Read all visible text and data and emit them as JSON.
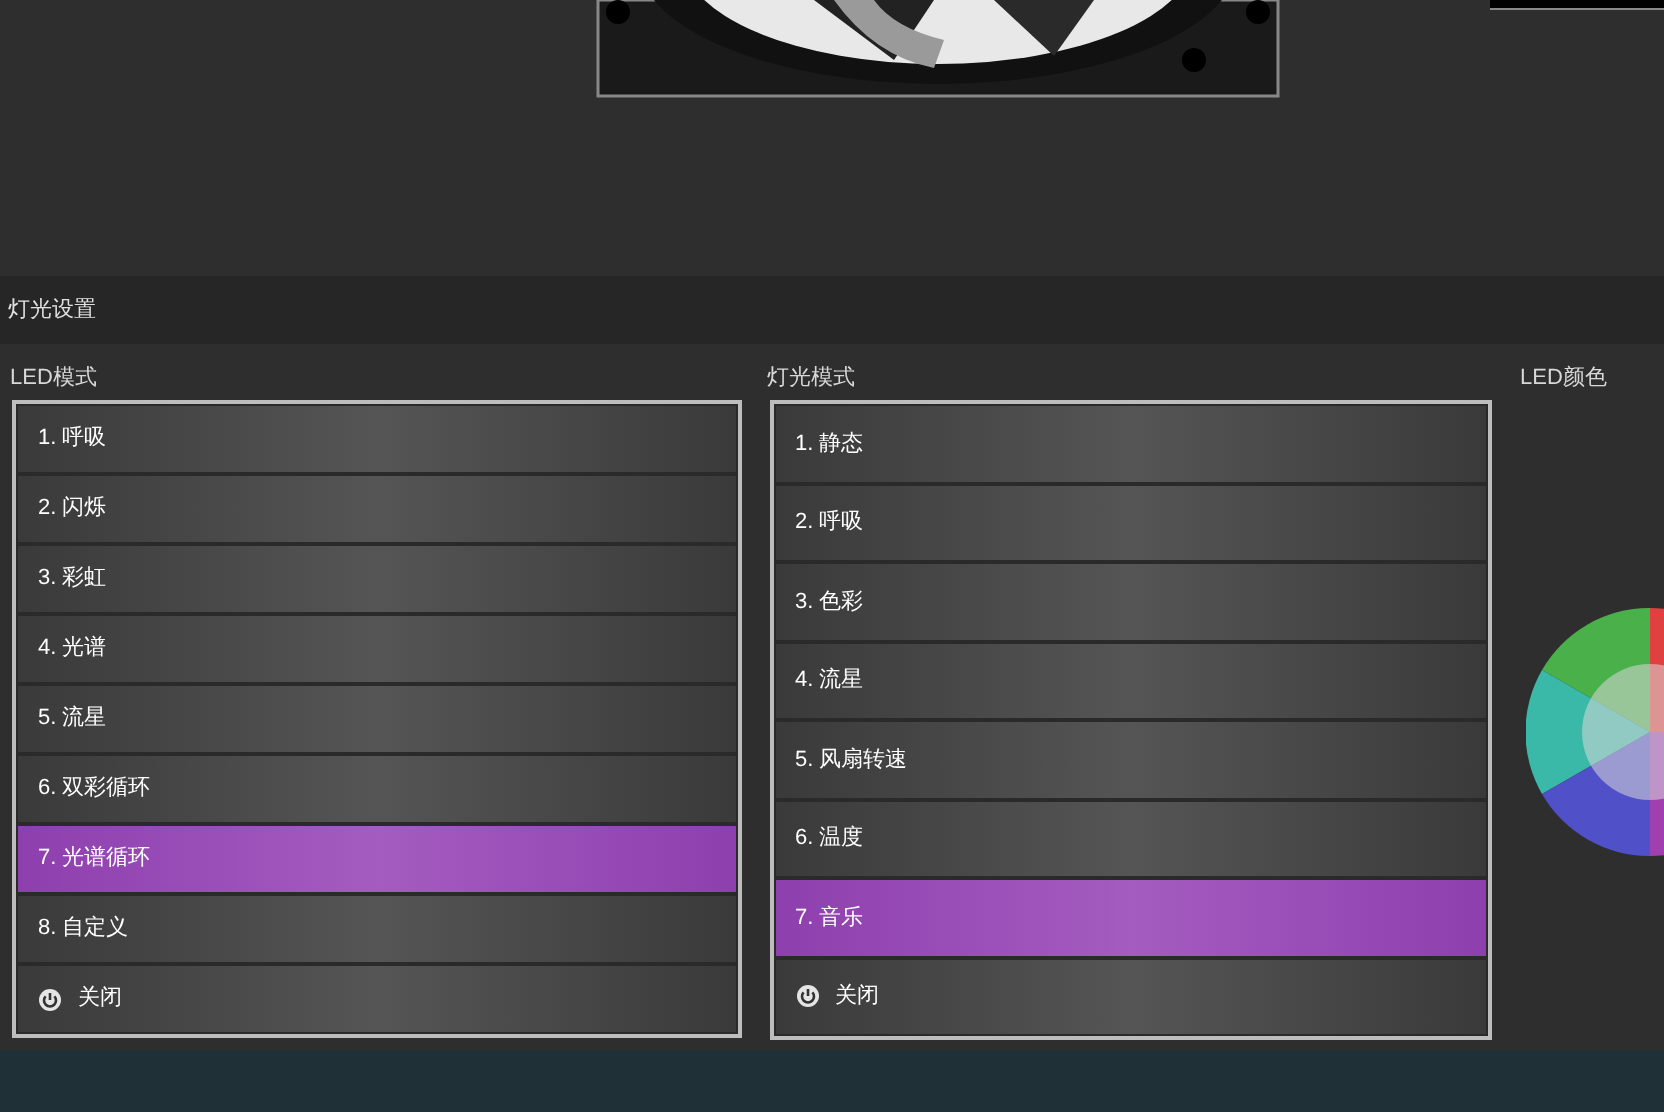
{
  "section_title": "灯光设置",
  "led_mode": {
    "label": "LED模式",
    "items": [
      {
        "text": "1. 呼吸",
        "selected": false
      },
      {
        "text": "2. 闪烁",
        "selected": false
      },
      {
        "text": "3. 彩虹",
        "selected": false
      },
      {
        "text": "4. 光谱",
        "selected": false
      },
      {
        "text": "5. 流星",
        "selected": false
      },
      {
        "text": "6. 双彩循环",
        "selected": false
      },
      {
        "text": "7. 光谱循环",
        "selected": true
      },
      {
        "text": "8. 自定义",
        "selected": false
      },
      {
        "text": "关闭",
        "selected": false,
        "kind": "off"
      }
    ]
  },
  "light_mode": {
    "label": "灯光模式",
    "items": [
      {
        "text": "1. 静态",
        "selected": false
      },
      {
        "text": "2. 呼吸",
        "selected": false
      },
      {
        "text": "3. 色彩",
        "selected": false
      },
      {
        "text": "4. 流星",
        "selected": false
      },
      {
        "text": "5. 风扇转速",
        "selected": false
      },
      {
        "text": "6. 温度",
        "selected": false
      },
      {
        "text": "7. 音乐",
        "selected": true
      },
      {
        "text": "关闭",
        "selected": false,
        "kind": "off"
      }
    ]
  },
  "led_color": {
    "label": "LED颜色"
  }
}
